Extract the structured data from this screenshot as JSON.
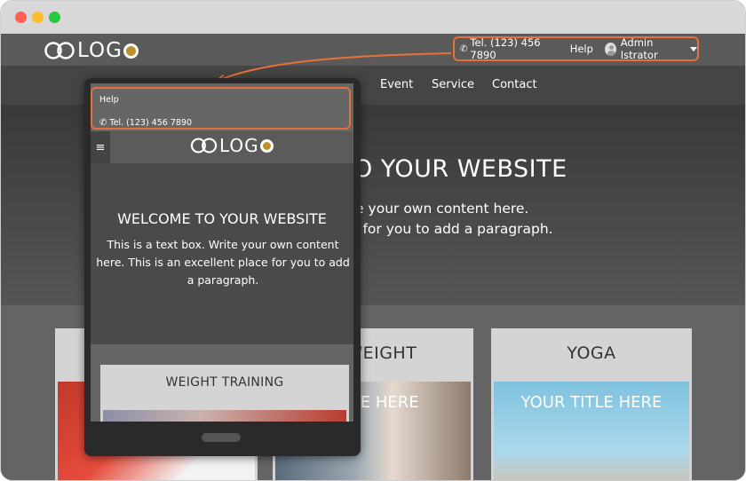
{
  "window": {
    "controls": [
      "close",
      "minimize",
      "maximize"
    ]
  },
  "site": {
    "logo_text": "LOG",
    "top_right": {
      "tel": "Tel. (123) 456 7890",
      "help": "Help",
      "user": "Admin Istrator"
    },
    "nav": [
      "Event",
      "Service",
      "Contact"
    ],
    "hero": {
      "title": "O YOUR WEBSITE",
      "line1": "te your own content here.",
      "line2": "e for you to add a paragraph."
    },
    "cards": [
      {
        "title": "Y WEIGHT",
        "photo_title": "TITLE HERE"
      },
      {
        "title": "YOGA",
        "photo_title": "YOUR TITLE HERE"
      }
    ]
  },
  "mobile": {
    "help": "Help",
    "tel": "Tel. (123) 456 7890",
    "logo_text": "LOG",
    "menu_icon": "≡",
    "hero": {
      "title": "WELCOME TO YOUR WEBSITE",
      "text": "This is a text box. Write your own content here. This is an excellent place for you to add a paragraph."
    },
    "card_title": "WEIGHT TRAINING"
  },
  "colors": {
    "accent": "#e8703a",
    "logo_o": "#b9902a"
  }
}
